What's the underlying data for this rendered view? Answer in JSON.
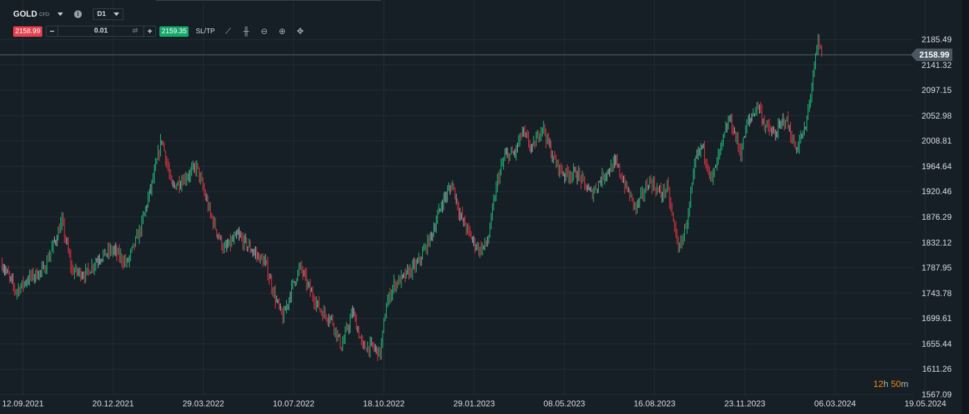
{
  "header": {
    "symbol": "GOLD",
    "instrument_type": "CFD",
    "timeframe": "D1",
    "info_icon": "info-icon"
  },
  "trade": {
    "sell_price": "2158.99",
    "buy_price": "2159.35",
    "quantity": "0.01",
    "minus": "−",
    "plus": "+",
    "sltp_label": "SL/TP"
  },
  "tools": [
    "line-chart-icon",
    "candles-icon",
    "zoom-out-icon",
    "zoom-in-icon",
    "crosshair-icon"
  ],
  "colors": {
    "up": "#1fc77f",
    "down": "#f23645",
    "neutral": "#b8bec4",
    "background": "#161f26",
    "grid": "#222c34"
  },
  "countdown": {
    "hours": "12",
    "h": "h ",
    "minutes": "50",
    "m": "m"
  },
  "chart_data": {
    "type": "ohlc",
    "current_price": 2158.99,
    "price_ticks": [
      "2185.49",
      "2141.32",
      "2097.15",
      "2052.98",
      "2008.81",
      "1964.64",
      "1920.46",
      "1876.29",
      "1832.12",
      "1787.95",
      "1743.78",
      "1699.61",
      "1655.44",
      "1611.26",
      "1567.09"
    ],
    "ylim": [
      1567.09,
      2185.49
    ],
    "date_ticks": [
      "12.09.2021",
      "20.12.2021",
      "29.03.2022",
      "10.07.2022",
      "18.10.2022",
      "29.01.2023",
      "08.05.2023",
      "16.08.2023",
      "23.11.2023",
      "06.03.2024",
      "19.05.2024"
    ],
    "approx_close_path": [
      [
        0,
        1795
      ],
      [
        11,
        1747
      ],
      [
        22,
        1771
      ],
      [
        33,
        1783
      ],
      [
        44,
        1844
      ],
      [
        48,
        1868
      ],
      [
        56,
        1783
      ],
      [
        67,
        1777
      ],
      [
        78,
        1807
      ],
      [
        89,
        1819
      ],
      [
        100,
        1795
      ],
      [
        111,
        1856
      ],
      [
        122,
        1952
      ],
      [
        128,
        2013
      ],
      [
        136,
        1928
      ],
      [
        144,
        1940
      ],
      [
        156,
        1964
      ],
      [
        167,
        1880
      ],
      [
        178,
        1819
      ],
      [
        189,
        1844
      ],
      [
        200,
        1819
      ],
      [
        211,
        1795
      ],
      [
        219,
        1735
      ],
      [
        225,
        1699
      ],
      [
        233,
        1759
      ],
      [
        239,
        1789
      ],
      [
        247,
        1747
      ],
      [
        256,
        1711
      ],
      [
        264,
        1699
      ],
      [
        272,
        1650
      ],
      [
        281,
        1711
      ],
      [
        289,
        1650
      ],
      [
        297,
        1650
      ],
      [
        303,
        1638
      ],
      [
        308,
        1723
      ],
      [
        314,
        1759
      ],
      [
        322,
        1771
      ],
      [
        333,
        1795
      ],
      [
        344,
        1844
      ],
      [
        353,
        1904
      ],
      [
        361,
        1934
      ],
      [
        367,
        1880
      ],
      [
        378,
        1832
      ],
      [
        383,
        1819
      ],
      [
        389,
        1832
      ],
      [
        397,
        1940
      ],
      [
        403,
        1982
      ],
      [
        411,
        1988
      ],
      [
        417,
        2025
      ],
      [
        425,
        1994
      ],
      [
        433,
        2037
      ],
      [
        442,
        1976
      ],
      [
        450,
        1952
      ],
      [
        461,
        1952
      ],
      [
        472,
        1916
      ],
      [
        483,
        1952
      ],
      [
        492,
        1970
      ],
      [
        500,
        1928
      ],
      [
        508,
        1892
      ],
      [
        519,
        1940
      ],
      [
        528,
        1916
      ],
      [
        533,
        1928
      ],
      [
        539,
        1856
      ],
      [
        543,
        1819
      ],
      [
        550,
        1880
      ],
      [
        556,
        1976
      ],
      [
        561,
        2001
      ],
      [
        569,
        1940
      ],
      [
        575,
        1988
      ],
      [
        583,
        2049
      ],
      [
        592,
        1988
      ],
      [
        597,
        2037
      ],
      [
        606,
        2073
      ],
      [
        611,
        2037
      ],
      [
        619,
        2019
      ],
      [
        628,
        2049
      ],
      [
        636,
        1994
      ],
      [
        644,
        2031
      ],
      [
        650,
        2121
      ],
      [
        654,
        2182
      ],
      [
        657,
        2158
      ]
    ]
  }
}
